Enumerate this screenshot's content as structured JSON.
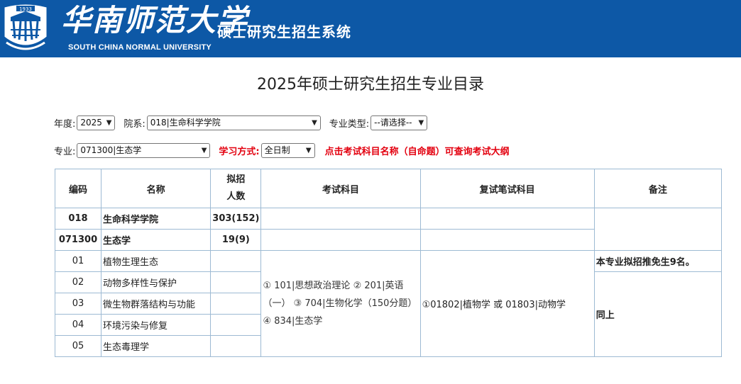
{
  "header": {
    "school_cn": "华南师范大学",
    "system_name": "硕士研究生招生系统",
    "school_en": "SOUTH CHINA NORMAL UNIVERSITY",
    "logo_year": "1933",
    "brand_color": "#0d58a6"
  },
  "page_title": "2025年硕士研究生招生专业目录",
  "filters": {
    "year_label": "年度:",
    "year_value": "2025",
    "dept_label": "院系:",
    "dept_value": "018|生命科学学院",
    "type_label": "专业类型:",
    "type_value": "--请选择--",
    "major_label": "专业:",
    "major_value": "071300|生态学",
    "mode_label": "学习方式:",
    "mode_value": "全日制",
    "tip": "点击考试科目名称（自命题）可查询考试大纲"
  },
  "table": {
    "headers": {
      "code": "编码",
      "name": "名称",
      "plan_1": "拟招",
      "plan_2": "人数",
      "exam": "考试科目",
      "retest": "复试笔试科目",
      "note": "备注"
    },
    "dept_row": {
      "code": "018",
      "name": "生命科学学院",
      "count": "303(152)"
    },
    "major_row": {
      "code": "071300",
      "name": "生态学",
      "count": "19(9)"
    },
    "directions": [
      {
        "code": "01",
        "name": "植物生理生态"
      },
      {
        "code": "02",
        "name": "动物多样性与保护"
      },
      {
        "code": "03",
        "name": "微生物群落结构与功能"
      },
      {
        "code": "04",
        "name": "环境污染与修复"
      },
      {
        "code": "05",
        "name": "生态毒理学"
      }
    ],
    "exam_subjects": "① 101|思想政治理论  ② 201|英语（一）  ③ 704|生物化学（150分题）  ④ 834|生态学",
    "retest_subjects": "①01802|植物学 或 01803|动物学",
    "note_1": "本专业拟招推免生9名。",
    "note_2": "同上"
  }
}
